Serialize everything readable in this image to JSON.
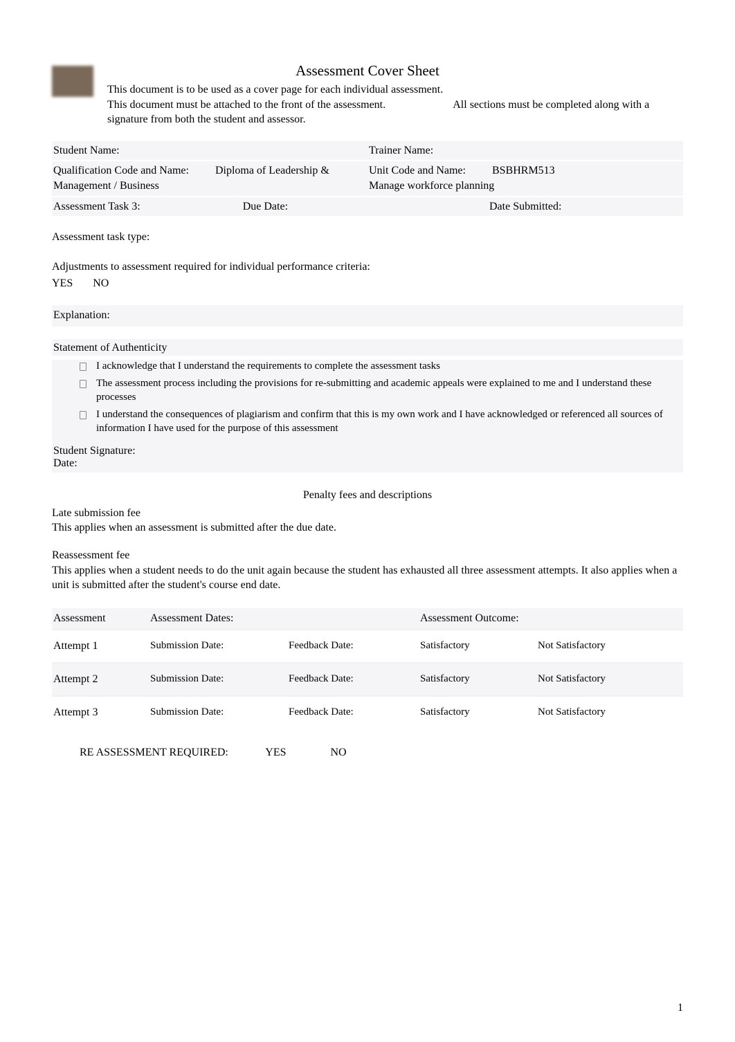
{
  "header": {
    "title": "Assessment Cover Sheet",
    "line1": "This document is to be used as a cover page for each individual assessment.",
    "line2a": "This document must be attached to the front of the assessment.",
    "line2b": "All sections must be completed along with a signature from both the student and assessor."
  },
  "info": {
    "student_name_label": "Student Name:",
    "student_name_value": "",
    "trainer_name_label": "Trainer Name:",
    "trainer_name_value": "",
    "qual_label": "Qualification Code and Name:",
    "qual_value": "Diploma of Leadership & Management / Business",
    "unit_label": "Unit Code and Name:",
    "unit_code": "BSBHRM513",
    "unit_name": "Manage workforce planning",
    "task_label": "Assessment Task 3:",
    "due_date_label": "Due Date:",
    "due_date_value": "",
    "date_submitted_label": "Date Submitted:",
    "date_submitted_value": ""
  },
  "task_type": {
    "label": "Assessment task type:",
    "value": ""
  },
  "adjustments": {
    "label": "Adjustments to assessment required for individual performance criteria:",
    "yes": "YES",
    "no": "NO"
  },
  "explanation": {
    "label": "Explanation:",
    "value": ""
  },
  "authenticity": {
    "heading": "Statement of Authenticity",
    "items": [
      "I acknowledge that I understand the requirements to complete the assessment tasks",
      "The assessment process including the provisions for re-submitting and academic appeals were explained to me and I understand these processes",
      "I understand the consequences of plagiarism and confirm that this is my own work and I have acknowledged or referenced all sources of information I have used for the purpose of this assessment"
    ],
    "signature_label": "Student Signature:",
    "date_label": "Date:"
  },
  "penalty": {
    "title": "Penalty fees and descriptions",
    "late_heading": "Late submission fee",
    "late_text": "This applies when an assessment is submitted after the due date.",
    "reassess_heading": "Reassessment fee",
    "reassess_text": "This applies when a student needs to do the unit again because the student has exhausted all three assessment attempts. It also applies when a unit is submitted after the student's course end date."
  },
  "assessment_table": {
    "headers": {
      "col1": "Assessment",
      "col2": "Assessment Dates:",
      "col3": "Assessment Outcome:"
    },
    "labels": {
      "submission": "Submission Date:",
      "feedback": "Feedback Date:",
      "satisfactory": "Satisfactory",
      "not_satisfactory": "Not Satisfactory"
    },
    "rows": [
      {
        "attempt": "Attempt 1"
      },
      {
        "attempt": "Attempt 2"
      },
      {
        "attempt": "Attempt 3"
      }
    ]
  },
  "reassessment": {
    "label": "RE ASSESSMENT REQUIRED:",
    "yes": "YES",
    "no": "NO"
  },
  "page_number": "1"
}
